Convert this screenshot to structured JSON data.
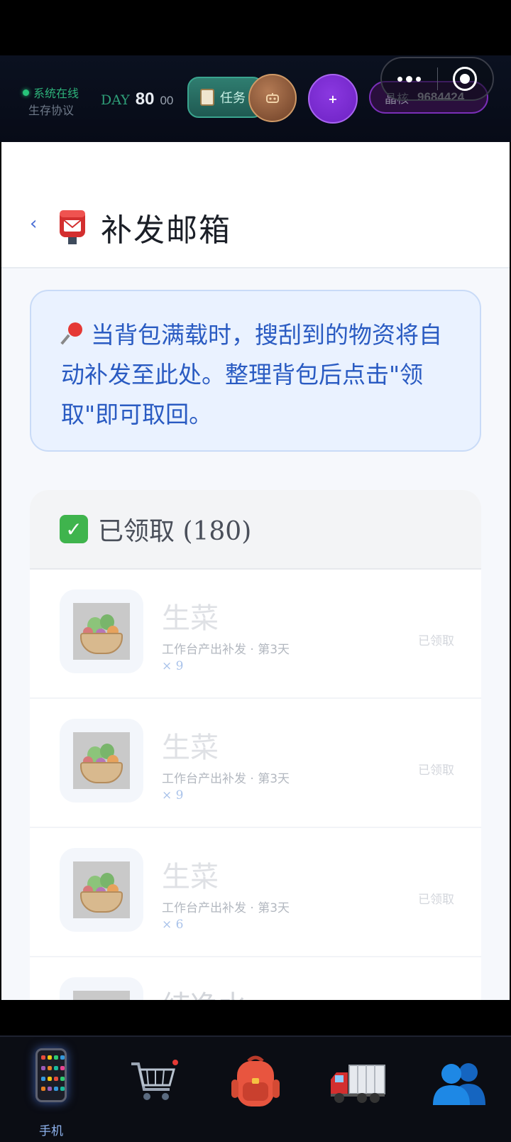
{
  "hud": {
    "status_line1": "系统在线",
    "status_line2": "生存协议",
    "day_label": "DAY",
    "day_number": "80",
    "day_sub": "00",
    "task_label": "任务",
    "plus_label": "+",
    "crystal_label": "晶核",
    "crystal_value": "9684424"
  },
  "page": {
    "back": "‹",
    "title": "补发邮箱"
  },
  "notice": {
    "text": "当背包满载时，搜刮到的物资将自动补发至此处。整理背包后点击\"领取\"即可取回。"
  },
  "section": {
    "title": "已领取 (180)"
  },
  "items": [
    {
      "name": "生菜",
      "meta": "工作台产出补发 · 第3天",
      "qty": "× 9",
      "state": "已领取"
    },
    {
      "name": "生菜",
      "meta": "工作台产出补发 · 第3天",
      "qty": "× 9",
      "state": "已领取"
    },
    {
      "name": "生菜",
      "meta": "工作台产出补发 · 第3天",
      "qty": "× 6",
      "state": "已领取"
    },
    {
      "name": "纯净水",
      "meta": "",
      "qty": "",
      "state": ""
    }
  ],
  "nav": {
    "items": [
      {
        "label": "手机",
        "icon": "phone-icon",
        "active": true
      },
      {
        "label": "",
        "icon": "cart-icon"
      },
      {
        "label": "",
        "icon": "backpack-icon"
      },
      {
        "label": "",
        "icon": "truck-icon"
      },
      {
        "label": "",
        "icon": "people-icon"
      }
    ]
  },
  "colors": {
    "accent_blue": "#2a5bc2",
    "notice_bg": "#eaf2ff",
    "online_green": "#27c47a",
    "crystal_purple": "#7a2fb8"
  }
}
